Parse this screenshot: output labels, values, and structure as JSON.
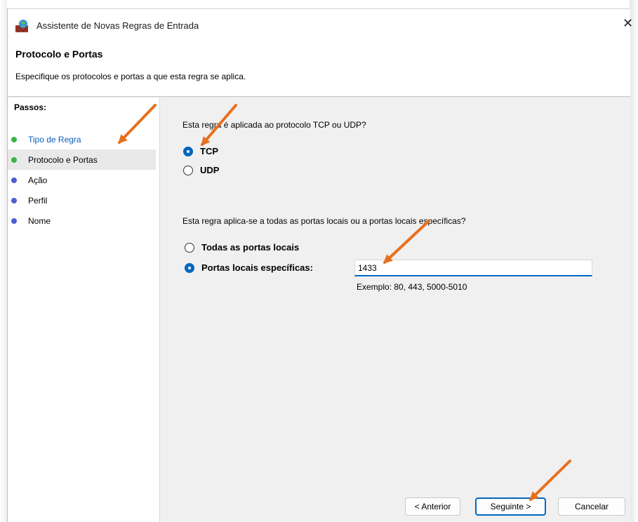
{
  "window": {
    "title": "Assistente de Novas Regras de Entrada",
    "close_glyph": "✕",
    "app_icon": "firewall-icon"
  },
  "header": {
    "title": "Protocolo e Portas",
    "subtitle": "Especifique os protocolos e portas a que esta regra se aplica."
  },
  "steps": {
    "title": "Passos:",
    "items": [
      {
        "label": "Tipo de Regra",
        "state": "completed"
      },
      {
        "label": "Protocolo e Portas",
        "state": "current"
      },
      {
        "label": "Ação",
        "state": "pending"
      },
      {
        "label": "Perfil",
        "state": "pending"
      },
      {
        "label": "Nome",
        "state": "pending"
      }
    ]
  },
  "protocol": {
    "question": "Esta regra é aplicada ao protocolo TCP ou UDP?",
    "options": [
      {
        "label": "TCP",
        "selected": true
      },
      {
        "label": "UDP",
        "selected": false
      }
    ]
  },
  "ports": {
    "question": "Esta regra aplica-se a todas as portas locais ou a portas locais específicas?",
    "options": [
      {
        "label": "Todas as portas locais",
        "selected": false
      },
      {
        "label": "Portas locais específicas:",
        "selected": true
      }
    ],
    "value": "1433",
    "example": "Exemplo: 80, 443, 5000-5010"
  },
  "buttons": {
    "back": "< Anterior",
    "next": "Seguinte >",
    "cancel": "Cancelar"
  },
  "colors": {
    "accent": "#0067c0",
    "link": "#0a5fb8",
    "step_done": "#3fb247",
    "step_pending": "#4a5fd0",
    "annotation_arrow": "#e8701e"
  }
}
